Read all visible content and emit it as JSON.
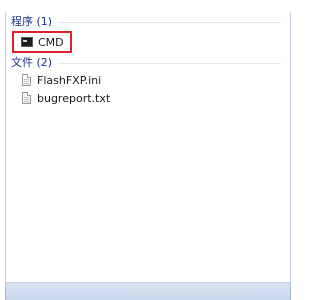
{
  "results": {
    "programs": {
      "header": "程序 (1)",
      "items": [
        {
          "label": "CMD",
          "icon": "cmd-icon"
        }
      ]
    },
    "files": {
      "header": "文件 (2)",
      "items": [
        {
          "label": "FlashFXP.ini",
          "icon": "file-icon"
        },
        {
          "label": "bugreport.txt",
          "icon": "file-icon"
        }
      ]
    }
  },
  "colors": {
    "group_header": "#1e3287",
    "highlight_border": "#d9232d",
    "panel_border": "#c7d3e3"
  }
}
